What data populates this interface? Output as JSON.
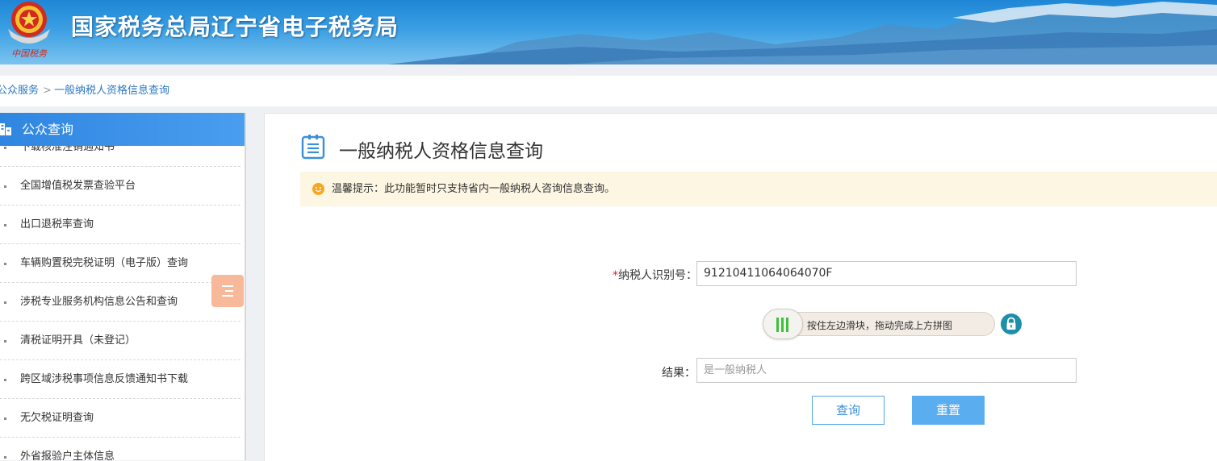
{
  "header": {
    "site_title": "国家税务总局辽宁省电子税务局",
    "emblem_caption": "中国税务"
  },
  "breadcrumb": {
    "items": [
      "公众服务",
      "一般纳税人资格信息查询"
    ],
    "separator": ">"
  },
  "sidebar": {
    "title": "公众查询",
    "items": [
      {
        "label": "下载核准注销通知书"
      },
      {
        "label": "全国增值税发票查验平台"
      },
      {
        "label": "出口退税率查询"
      },
      {
        "label": "车辆购置税完税证明（电子版）查询"
      },
      {
        "label": "涉税专业服务机构信息公告和查询"
      },
      {
        "label": "清税证明开具（未登记）"
      },
      {
        "label": "跨区域涉税事项信息反馈通知书下载"
      },
      {
        "label": "无欠税证明查询"
      },
      {
        "label": "外省报验户主体信息"
      }
    ]
  },
  "main": {
    "title": "一般纳税人资格信息查询",
    "notice": "温馨提示：此功能暂时只支持省内一般纳税人咨询信息查询。",
    "form": {
      "taxpayer_id_required": "*",
      "taxpayer_id_label": "纳税人识别号：",
      "taxpayer_id_value": "91210411064064070F",
      "slider_hint": "按住左边滑块，拖动完成上方拼图",
      "result_label": "结果：",
      "result_placeholder": "是一般纳税人"
    },
    "buttons": {
      "query": "查询",
      "reset": "重置"
    }
  },
  "colors": {
    "accent": "#2f86e0",
    "notice_bg": "#fdf6e3",
    "button_primary": "#5aaeef",
    "required": "#e02020",
    "slider_bar": "#3cc13c"
  },
  "icons": {
    "sidebar_head": "building-icon",
    "title": "document-icon",
    "notice": "smile-icon",
    "lock": "lock-icon",
    "float_menu": "menu-icon"
  }
}
